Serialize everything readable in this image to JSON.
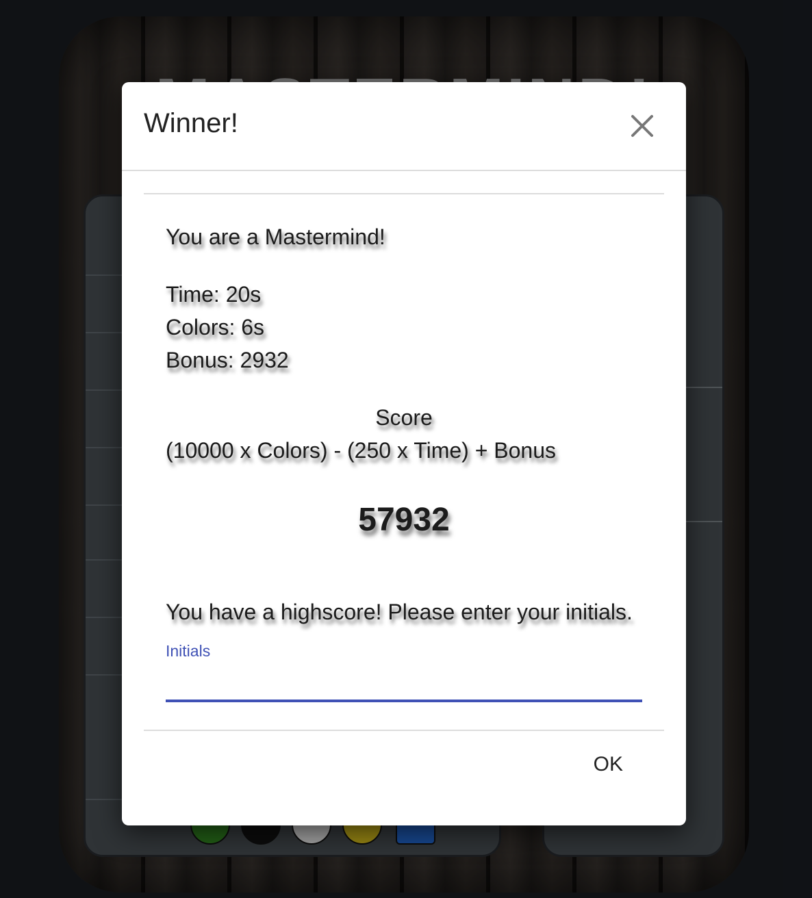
{
  "background": {
    "game_title": "MASTERMIND!",
    "peg_colors": [
      "#2e7d1e",
      "#111111",
      "#d9d9d9",
      "#c8b21a",
      "#1f5fbf"
    ]
  },
  "modal": {
    "title": "Winner!",
    "close_icon": "close-icon",
    "message": "You are a Mastermind!",
    "stats": {
      "time": "Time: 20s",
      "colors": "Colors: 6s",
      "bonus": "Bonus: 2932"
    },
    "score_label": "Score",
    "formula": "(10000 x Colors) - (250 x Time) + Bonus",
    "score_value": "57932",
    "highscore_message": "You have a highscore! Please enter your initials.",
    "initials": {
      "label": "Initials",
      "value": ""
    },
    "ok_label": "OK"
  },
  "colors": {
    "accent": "#3f51b5",
    "text": "#222222"
  }
}
